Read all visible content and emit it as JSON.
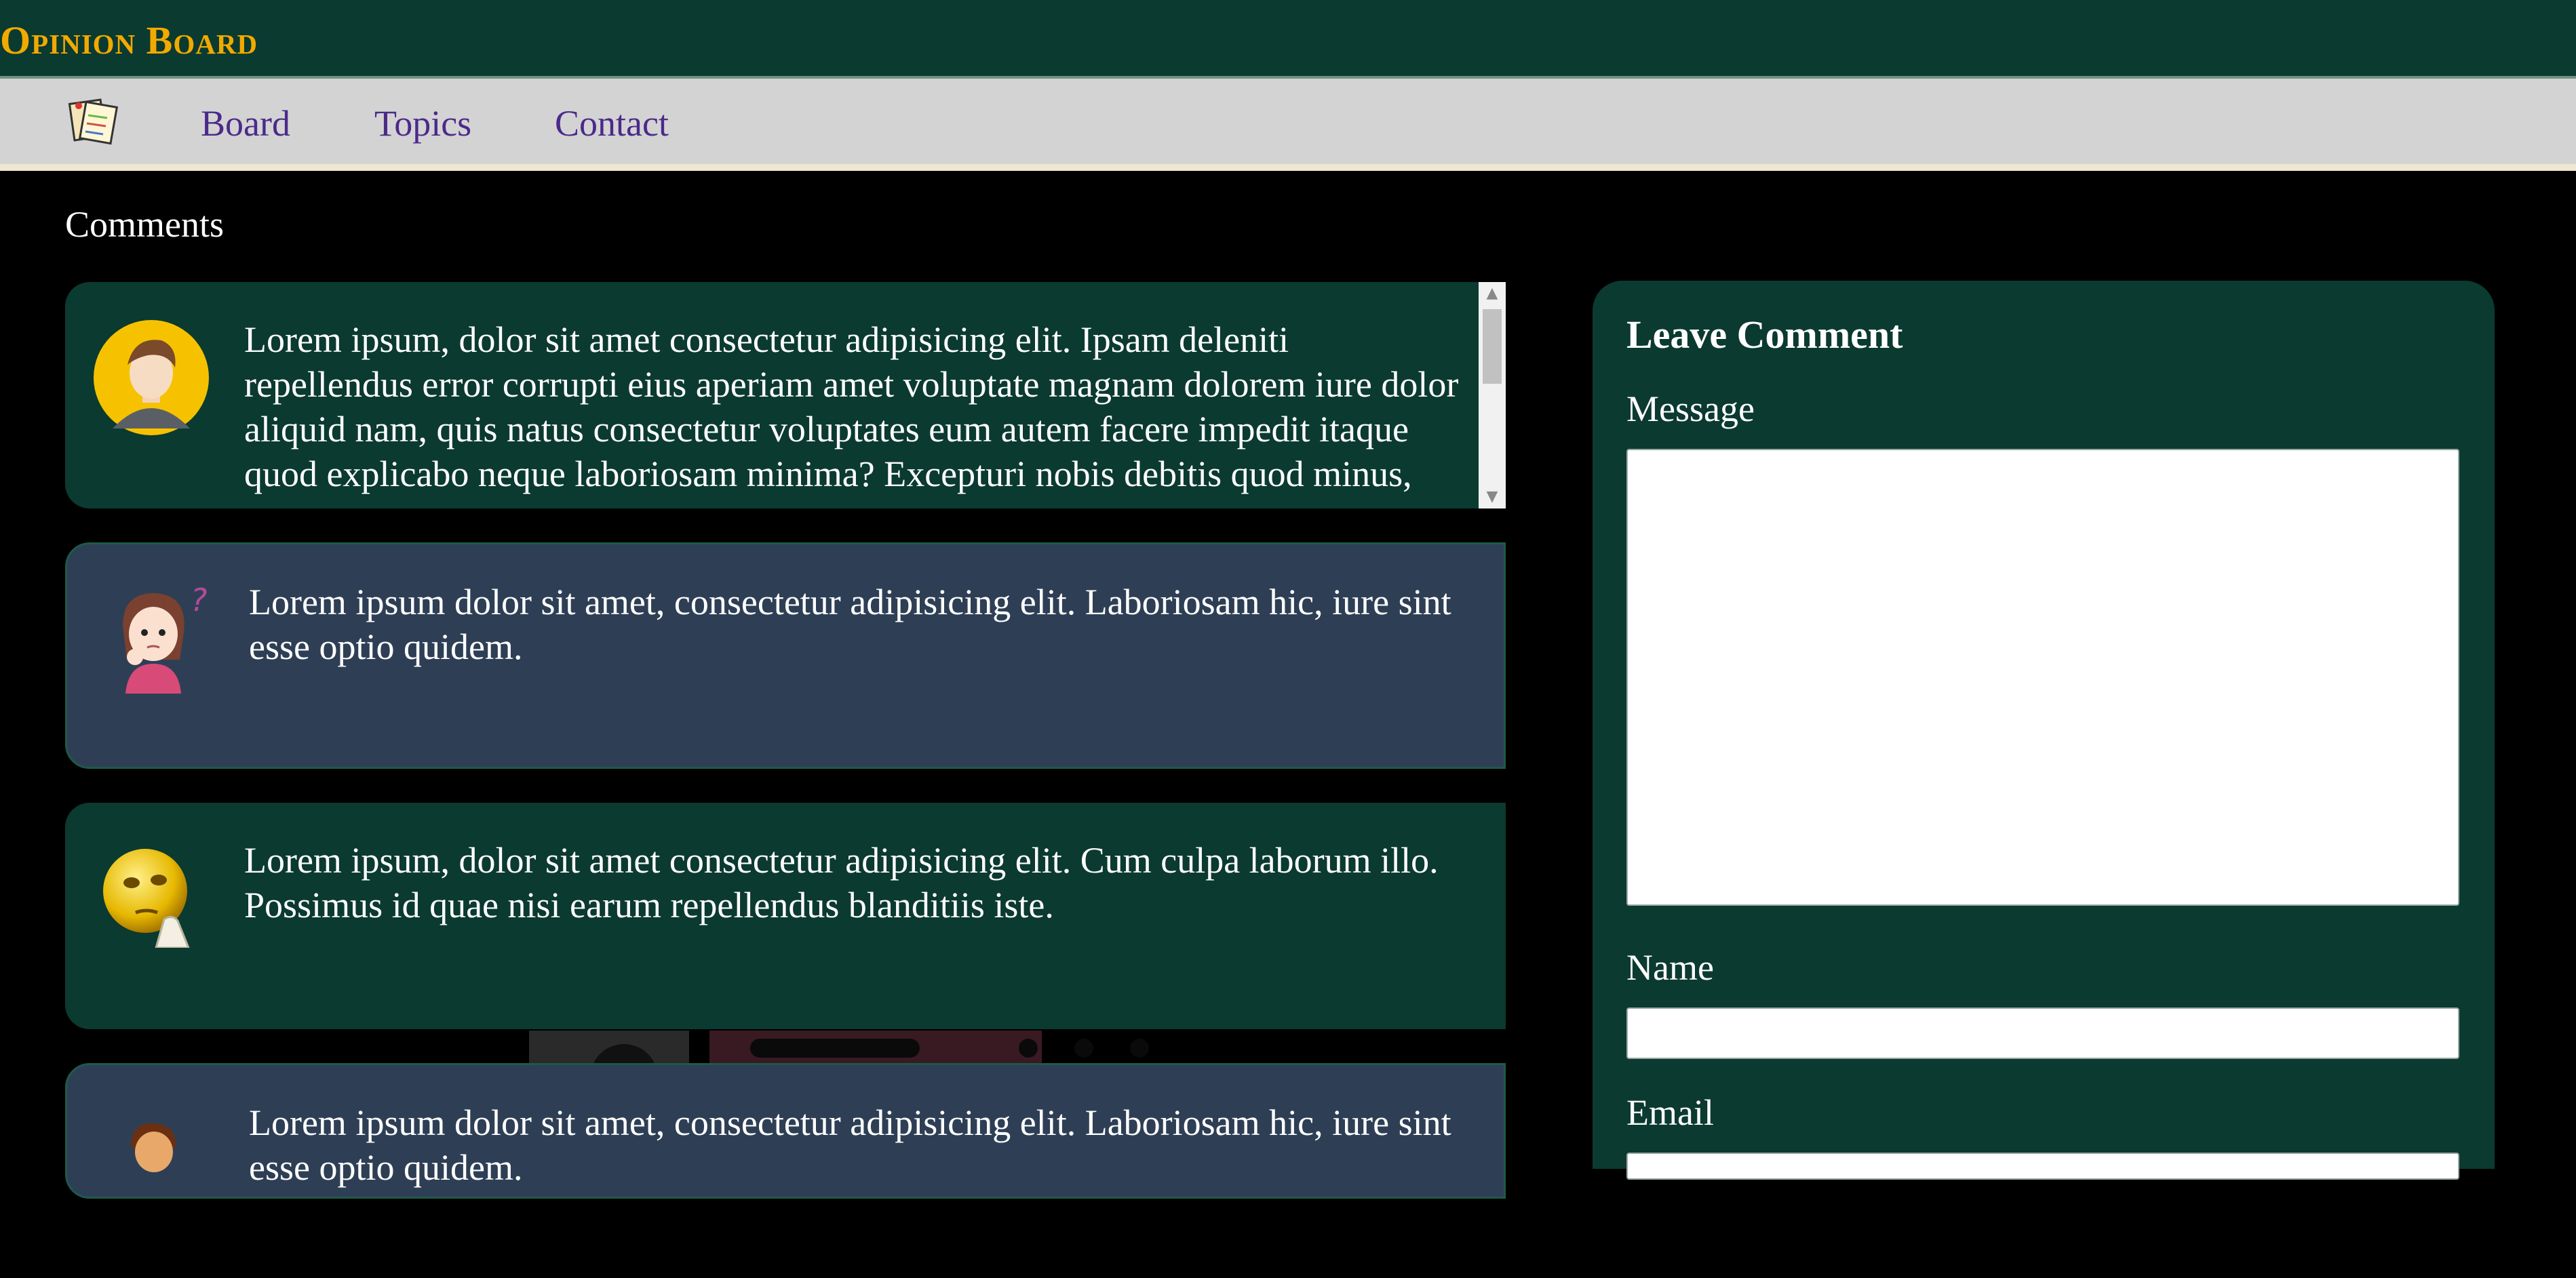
{
  "brand": {
    "title": "Opinion Board",
    "color": "#f2a900"
  },
  "nav": {
    "logo_icon": "notes-logo-icon",
    "links": [
      {
        "label": "Board"
      },
      {
        "label": "Topics"
      },
      {
        "label": "Contact"
      }
    ]
  },
  "comments_section": {
    "title": "Comments",
    "items": [
      {
        "avatar": "man-avatar-icon",
        "text": "Lorem ipsum, dolor sit amet consectetur adipisicing elit. Ipsam deleniti repellendus error corrupti eius aperiam amet voluptate magnam dolorem iure dolor aliquid nam, quis natus consectetur voluptates eum autem facere impedit itaque quod explicabo neque laboriosam minima? Excepturi nobis debitis quod minus, assumenda expedita tempora aliquid ad perferendis."
      },
      {
        "avatar": "thinking-woman-avatar-icon",
        "text": "Lorem ipsum dolor sit amet, consectetur adipisicing elit. Laboriosam hic, iure sint esse optio quidem."
      },
      {
        "avatar": "thinking-emoji-avatar-icon",
        "text": "Lorem ipsum, dolor sit amet consectetur adipisicing elit. Cum culpa laborum illo. Possimus id quae nisi earum repellendus blanditiis iste."
      },
      {
        "avatar": "boy-avatar-icon",
        "text": "Lorem ipsum dolor sit amet, consectetur adipisicing elit. Laboriosam hic, iure sint esse optio quidem."
      }
    ]
  },
  "form": {
    "title": "Leave Comment",
    "message_label": "Message",
    "message_value": "",
    "name_label": "Name",
    "name_value": "",
    "email_label": "Email",
    "email_value": ""
  },
  "colors": {
    "header_bg": "#0b3a30",
    "nav_bg": "#d3d3d3",
    "link": "#4b2a8a",
    "card_green": "#0b3a30",
    "card_slate": "#2e3f55",
    "page_bg": "#000000"
  }
}
